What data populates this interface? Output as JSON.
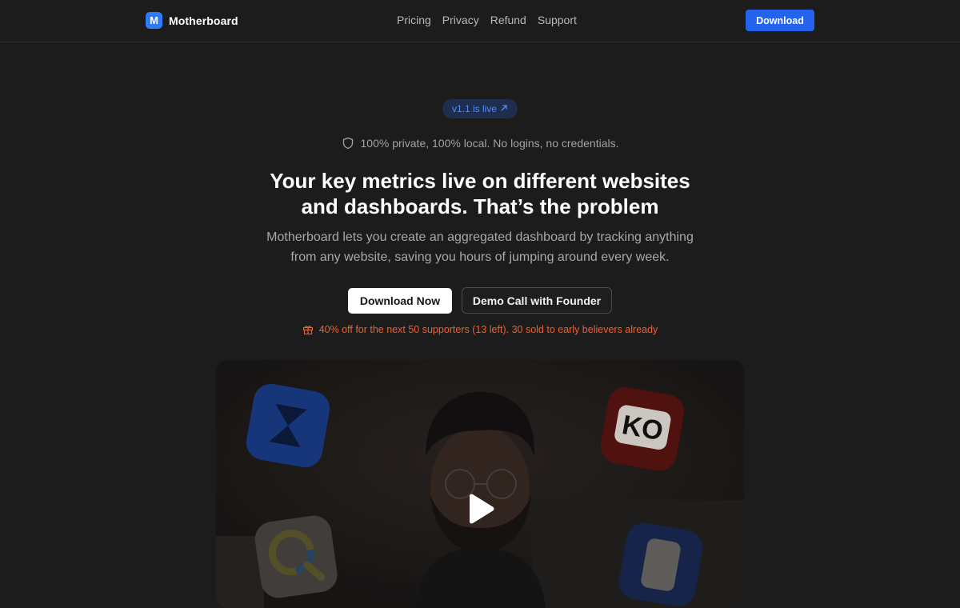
{
  "header": {
    "brand_letter": "M",
    "brand_name": "Motherboard",
    "nav": [
      "Pricing",
      "Privacy",
      "Refund",
      "Support"
    ],
    "download_label": "Download",
    "accent": "#2463eb"
  },
  "hero": {
    "badge": "v1.1 is live",
    "privacy": "100% private, 100% local. No logins, no credentials.",
    "title_line1": "Your key metrics live on different websites",
    "title_line2": "and dashboards. That’s the problem",
    "subtitle_line1": "Motherboard lets you create an aggregated dashboard by tracking anything",
    "subtitle_line2": "from any website, saving you hours of jumping around every week.",
    "primary_cta": "Download Now",
    "secondary_cta": "Demo Call with Founder",
    "promo": "40% off for the next 50 supporters (13 left). 30 sold to early believers already",
    "promo_color": "#f0602c"
  },
  "video": {
    "icons": [
      "hourglass-app-icon",
      "ko-app-icon",
      "magnifier-app-icon",
      "phone-app-icon"
    ],
    "logo_text": "KO"
  }
}
